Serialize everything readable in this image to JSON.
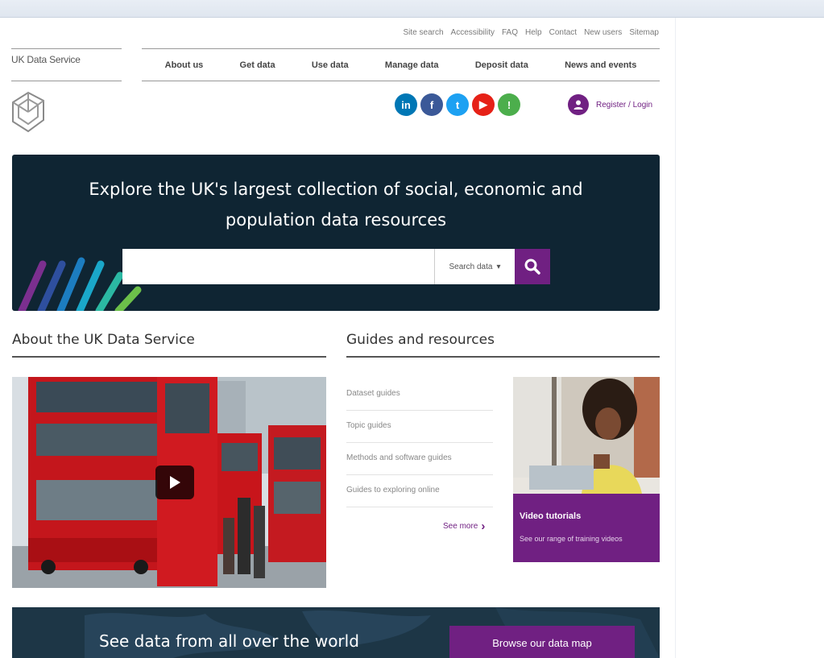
{
  "utility_nav": [
    "Site search",
    "Accessibility",
    "FAQ",
    "Help",
    "Contact",
    "New users",
    "Sitemap"
  ],
  "brand": {
    "name": "UK Data Service"
  },
  "main_nav": [
    "About us",
    "Get data",
    "Use data",
    "Manage data",
    "Deposit data",
    "News and events"
  ],
  "social": [
    {
      "icon": "linkedin-icon",
      "glyph": "in",
      "color": "#0077b5"
    },
    {
      "icon": "facebook-icon",
      "glyph": "f",
      "color": "#3b5998"
    },
    {
      "icon": "twitter-icon",
      "glyph": "t",
      "color": "#1da1f2"
    },
    {
      "icon": "youtube-icon",
      "glyph": "▶",
      "color": "#e62117"
    },
    {
      "icon": "blog-icon",
      "glyph": "!",
      "color": "#4cae4c"
    }
  ],
  "account": {
    "label": "Register / Login"
  },
  "hero": {
    "title_line1": "Explore the UK's largest collection of social, economic and",
    "title_line2": "population data resources",
    "search_placeholder": "",
    "search_dropdown": "Search data",
    "search_button_icon": "search-icon"
  },
  "about": {
    "heading": "About the UK Data Service"
  },
  "guides": {
    "heading": "Guides and resources",
    "items": [
      "Dataset guides",
      "Topic guides",
      "Methods and software guides",
      "Guides to exploring online"
    ],
    "see_more": "See more"
  },
  "video_tutorials": {
    "title": "Video tutorials",
    "subtitle": "See our range of training videos"
  },
  "map_band": {
    "text": "See data from all over the world",
    "button": "Browse our data map"
  },
  "colors": {
    "accent": "#702082",
    "hero_bg": "#0f2533",
    "band_bg": "#1d3646"
  }
}
